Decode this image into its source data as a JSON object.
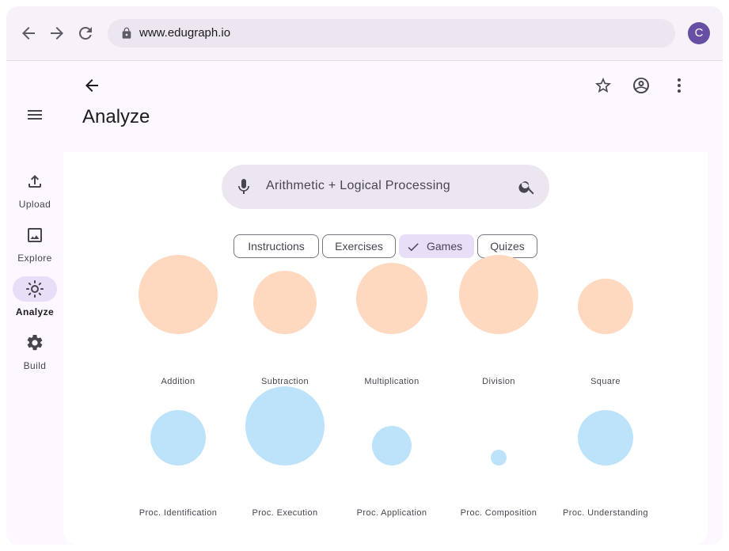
{
  "browser": {
    "url": "www.edugraph.io",
    "profile_initial": "C",
    "icons": [
      "back-arrow-icon",
      "forward-arrow-icon",
      "reload-icon",
      "lock-icon"
    ]
  },
  "rail": {
    "menu_icon": "hamburger-menu-icon",
    "items": [
      {
        "label": "Upload",
        "icon": "upload-icon",
        "active": false
      },
      {
        "label": "Explore",
        "icon": "image-icon",
        "active": false
      },
      {
        "label": "Analyze",
        "icon": "brightness-icon",
        "active": true
      },
      {
        "label": "Build",
        "icon": "gear-icon",
        "active": false
      }
    ]
  },
  "header": {
    "title": "Analyze",
    "actions": [
      "star-icon",
      "account-circle-icon",
      "more-vert-icon"
    ]
  },
  "search": {
    "query": "Arithmetic + Logical Processing"
  },
  "filters": [
    {
      "label": "Instructions",
      "selected": false
    },
    {
      "label": "Exercises",
      "selected": false
    },
    {
      "label": "Games",
      "selected": true
    },
    {
      "label": "Quizes",
      "selected": false
    }
  ],
  "topics": {
    "arithmetic": [
      {
        "label": "Addition",
        "size": 1.0
      },
      {
        "label": "Subtraction",
        "size": 0.8
      },
      {
        "label": "Multiplication",
        "size": 0.9
      },
      {
        "label": "Division",
        "size": 1.0
      },
      {
        "label": "Square",
        "size": 0.7
      }
    ],
    "procedural": [
      {
        "label": "Proc. Identification",
        "size": 0.7
      },
      {
        "label": "Proc. Execution",
        "size": 1.0
      },
      {
        "label": "Proc. Application",
        "size": 0.5
      },
      {
        "label": "Proc. Composition",
        "size": 0.2
      },
      {
        "label": "Proc. Understanding",
        "size": 0.7
      }
    ]
  },
  "colors": {
    "arithmetic_bubble": "#ffd8c0",
    "procedural_bubble": "#bde3fb",
    "accent": "#6750a4",
    "selected_chip": "#e8def8"
  }
}
